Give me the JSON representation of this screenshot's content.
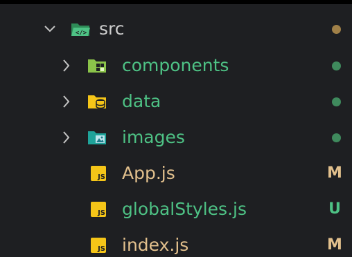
{
  "colors": {
    "background": "#1e1f22",
    "default_text": "#cccccc",
    "untracked_green": "#4ec285",
    "modified_yellow": "#e2c08d",
    "chevron": "#c5c5c5",
    "dot_modified": "#a08048",
    "dot_untracked": "#3f8a5d",
    "js_icon": "#f5c518"
  },
  "tree": {
    "src": {
      "label": "src",
      "expanded": true,
      "icon": "folder-src-open-icon",
      "status": "modified-dot"
    },
    "children": [
      {
        "label": "components",
        "type": "folder",
        "icon": "folder-components-icon",
        "status": "untracked-dot"
      },
      {
        "label": "data",
        "type": "folder",
        "icon": "folder-data-icon",
        "status": "untracked-dot"
      },
      {
        "label": "images",
        "type": "folder",
        "icon": "folder-images-icon",
        "status": "untracked-dot"
      },
      {
        "label": "App.js",
        "type": "file",
        "icon": "javascript-file-icon",
        "status_badge": "M"
      },
      {
        "label": "globalStyles.js",
        "type": "file",
        "icon": "javascript-file-icon",
        "status_badge": "U"
      },
      {
        "label": "index.js",
        "type": "file",
        "icon": "javascript-file-icon",
        "status_badge": "M"
      }
    ]
  },
  "js_icon_text": "JS"
}
